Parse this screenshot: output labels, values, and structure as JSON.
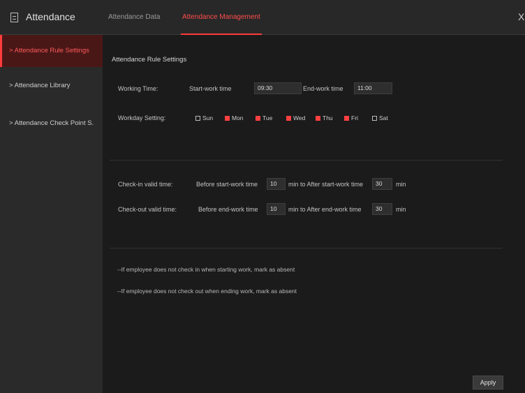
{
  "header": {
    "app_title": "Attendance",
    "icon": "document-icon",
    "tabs": [
      {
        "label": "Attendance Data",
        "active": false
      },
      {
        "label": "Attendance Management",
        "active": true
      }
    ],
    "close_symbol": "X"
  },
  "sidebar": {
    "items": [
      {
        "label": "> Attendance Rule Settings",
        "active": true
      },
      {
        "label": "> Attendance Library",
        "active": false
      },
      {
        "label": "> Attendance Check Point S.",
        "active": false
      }
    ]
  },
  "main": {
    "section_title": "Attendance Rule Settings",
    "working_time": {
      "label": "Working Time:",
      "start_label": "Start-work time",
      "start_value": "09:30",
      "end_label": "End-work time",
      "end_value": "11:00"
    },
    "workday": {
      "label": "Workday Setting:",
      "days": [
        {
          "label": "Sun",
          "checked": false
        },
        {
          "label": "Mon",
          "checked": true
        },
        {
          "label": "Tue",
          "checked": true
        },
        {
          "label": "Wed",
          "checked": true
        },
        {
          "label": "Thu",
          "checked": true
        },
        {
          "label": "Fri",
          "checked": true
        },
        {
          "label": "Sat",
          "checked": false
        }
      ]
    },
    "check_in": {
      "label": "Check-in valid time:",
      "before_label": "Before start-work time",
      "before_value": "10",
      "mid_label": "min  to  After start-work time",
      "after_value": "30",
      "unit": "min"
    },
    "check_out": {
      "label": "Check-out valid time:",
      "before_label": "Before end-work time",
      "before_value": "10",
      "mid_label": "min  to  After end-work time",
      "after_value": "30",
      "unit": "min"
    },
    "notes": [
      "--If employee does not check in when starting work, mark as absent",
      "--If employee does not check out when ending work, mark as absent"
    ],
    "apply_label": "Apply"
  },
  "colors": {
    "accent": "#ff3b3b",
    "background": "#1b1b1b",
    "sidebar": "#2a2a2a",
    "header": "#282828"
  }
}
